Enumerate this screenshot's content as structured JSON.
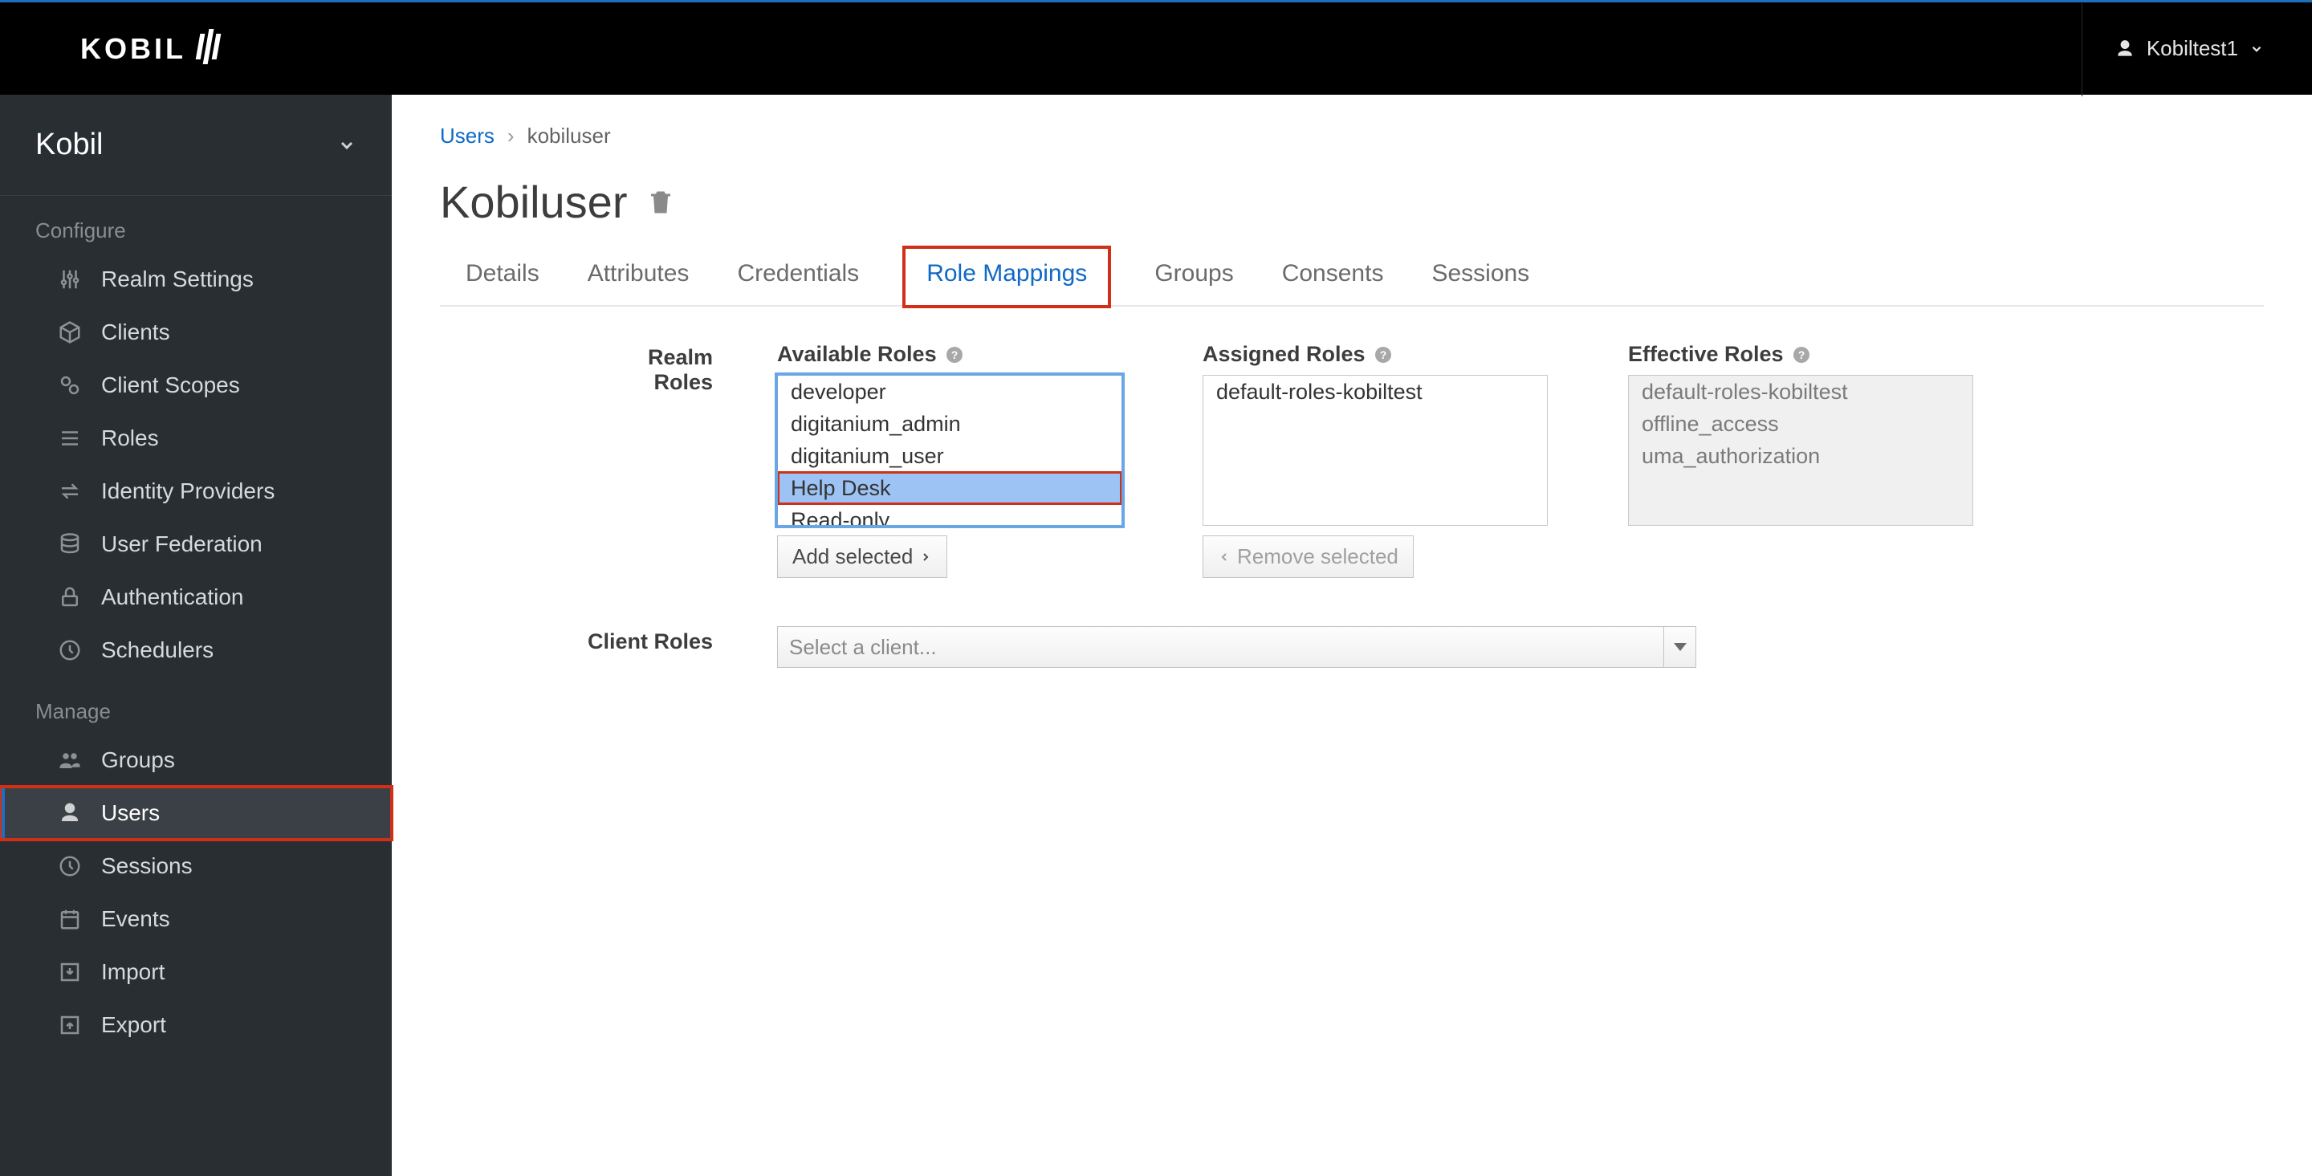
{
  "header": {
    "logo_text": "KOBIL",
    "user_label": "Kobiltest1"
  },
  "sidebar": {
    "realm": "Kobil",
    "section_configure": "Configure",
    "section_manage": "Manage",
    "configure_items": [
      {
        "label": "Realm Settings"
      },
      {
        "label": "Clients"
      },
      {
        "label": "Client Scopes"
      },
      {
        "label": "Roles"
      },
      {
        "label": "Identity Providers"
      },
      {
        "label": "User Federation"
      },
      {
        "label": "Authentication"
      },
      {
        "label": "Schedulers"
      }
    ],
    "manage_items": [
      {
        "label": "Groups"
      },
      {
        "label": "Users"
      },
      {
        "label": "Sessions"
      },
      {
        "label": "Events"
      },
      {
        "label": "Import"
      },
      {
        "label": "Export"
      }
    ]
  },
  "breadcrumb": {
    "parent": "Users",
    "current": "kobiluser"
  },
  "page": {
    "title": "Kobiluser"
  },
  "tabs": [
    {
      "label": "Details"
    },
    {
      "label": "Attributes"
    },
    {
      "label": "Credentials"
    },
    {
      "label": "Role Mappings"
    },
    {
      "label": "Groups"
    },
    {
      "label": "Consents"
    },
    {
      "label": "Sessions"
    }
  ],
  "role_mappings": {
    "realm_roles_label": "Realm Roles",
    "client_roles_label": "Client Roles",
    "available_label": "Available Roles",
    "assigned_label": "Assigned Roles",
    "effective_label": "Effective Roles",
    "available": [
      "developer",
      "digitanium_admin",
      "digitanium_user",
      "Help Desk",
      "Read-only"
    ],
    "assigned": [
      "default-roles-kobiltest"
    ],
    "effective": [
      "default-roles-kobiltest",
      "offline_access",
      "uma_authorization"
    ],
    "add_button": "Add selected",
    "remove_button": "Remove selected",
    "client_placeholder": "Select a client..."
  }
}
